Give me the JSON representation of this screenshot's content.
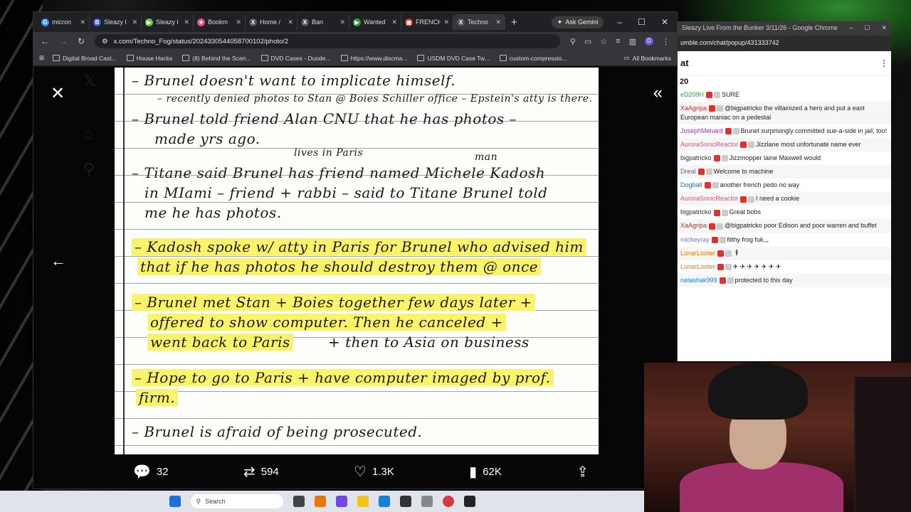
{
  "browser": {
    "tabs": [
      {
        "label": "micron",
        "color": "#4285f4",
        "glyph": "G"
      },
      {
        "label": "Sleazy l",
        "color": "#3b5bdb",
        "glyph": "B"
      },
      {
        "label": "Sleazy l",
        "color": "#65c23a",
        "glyph": "▶"
      },
      {
        "label": "Bookm",
        "color": "#e64980",
        "glyph": "★"
      },
      {
        "label": "Home /",
        "color": "#555",
        "glyph": "X"
      },
      {
        "label": "Ban",
        "color": "#555",
        "glyph": "X"
      },
      {
        "label": "Wanted",
        "color": "#2f9e44",
        "glyph": "▶"
      },
      {
        "label": "FRENCH",
        "color": "#c92a2a",
        "glyph": "▣"
      },
      {
        "label": "Techno",
        "color": "#555",
        "glyph": "X"
      }
    ],
    "new_tab": "+",
    "gemini_label": "Ask Gemini",
    "url": "x.com/Techno_Fog/status/2024330544058700102/photo/2",
    "profile_initial": "D",
    "bookmarks": [
      "Digital Broad Cast...",
      "House Hacks",
      "(8) Behind the Scen...",
      "DVD Cases - Duode...",
      "https://www.discma...",
      "USDM DVD Case Tw...",
      "custom-compressio..."
    ],
    "all_bookmarks": "All Bookmarks"
  },
  "note": {
    "lines": [
      "– Brunel doesn't want to implicate himself.",
      "– recently denied photos to Stan @ Boies Schiller office – Epstein's atty is there.",
      "– Brunel told friend Alan CNU that he has photos –",
      "made yrs ago.",
      "lives in Paris",
      "man",
      "– Titane said Brunel has friend named Michele Kadosh",
      "in MIami – friend + rabbi – said to Titane Brunel told",
      "me he has photos.",
      "– Kadosh spoke w/ atty in Paris for Brunel who advised him",
      "that if he has photos he should destroy them @ once",
      "– Brunel met Stan + Boies together few days later +",
      "offered to show computer. Then he canceled +",
      "went back to Paris",
      "+ then to Asia on business",
      "– Hope to go to Paris + have computer imaged by prof.",
      "firm.",
      "– Brunel is afraid of being prosecuted."
    ]
  },
  "actions": {
    "replies": "32",
    "reposts": "594",
    "likes": "1.3K",
    "views": "62K"
  },
  "chat": {
    "window_title": "Sleazy Live From the Bunker 3/11/26 - Google Chrome",
    "url": "umble.com/chat/popup/431333742",
    "header": "at",
    "count": "20",
    "messages": [
      {
        "user": "eD209H",
        "text": "SURE",
        "color": "#2f9e44"
      },
      {
        "user": "XaAgripa",
        "text": "@bigpatricko the villainized a hero and put a east European maniac on a pedestal",
        "color": "#c92a2a"
      },
      {
        "user": "JosephMenard",
        "text": "Brunel surprisingly committed sue-a-side in jail, too!",
        "color": "#9c36b5"
      },
      {
        "user": "AuroraSonicReactor",
        "text": "Jizzlane most unfortunate name ever",
        "color": "#e64980"
      },
      {
        "user": "bigpatricko",
        "text": "Jizzmopper laine Maxwell would",
        "color": "#333"
      },
      {
        "user": "Dreal",
        "text": "Welcome to machine",
        "color": "#7048e8"
      },
      {
        "user": "Dogball",
        "text": "another french pedo no way",
        "color": "#1971c2"
      },
      {
        "user": "AuroraSonicReactor",
        "text": "I need a cookie",
        "color": "#e64980"
      },
      {
        "user": "bigpatricko",
        "text": "Great bobs",
        "color": "#333"
      },
      {
        "user": "XaAgripa",
        "text": "@bigpatricko poor Edison and poor warren and buffet",
        "color": "#c92a2a"
      },
      {
        "user": "mickeyray",
        "text": "filthy frog fuk,,,",
        "color": "#5c7cfa"
      },
      {
        "user": "LunarLooter",
        "text": "🕴",
        "color": "#e67700"
      },
      {
        "user": "LunarLooter",
        "text": "✈ ✈ ✈ ✈ ✈ ✈ ✈",
        "color": "#e67700"
      },
      {
        "user": "natashak999",
        "text": "protected to this day",
        "color": "#1c7ed6"
      }
    ]
  },
  "taskbar": {
    "search_placeholder": "Search"
  }
}
